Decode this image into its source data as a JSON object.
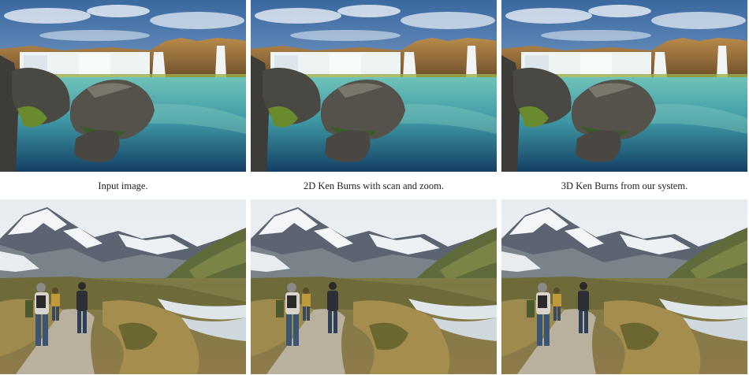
{
  "captions": {
    "input": "Input image.",
    "ken_burns_2d": "2D Ken Burns with scan and zoom.",
    "ken_burns_3d": "3D Ken Burns from our system."
  },
  "scenes": {
    "waterfall": {
      "sky_top": "#3f6ea5",
      "sky_bottom": "#a9c7e4",
      "cliff": "#9a6f3b",
      "falls": "#eef3f4",
      "lagoon_top": "#5fb5b0",
      "lagoon_bottom": "#1d5a7e",
      "rock": "#4c4a45",
      "moss": "#6a8a2e"
    },
    "mountain": {
      "sky": "#eef2f5",
      "snow": "#f3f5f7",
      "rock": "#5b6470",
      "hill": "#5f6b3a",
      "scrub": "#9d8a4c",
      "path": "#b9b09e",
      "river": "#dfe6ea",
      "jacket": "#d8d4cc",
      "jeans": "#3b5575"
    }
  }
}
